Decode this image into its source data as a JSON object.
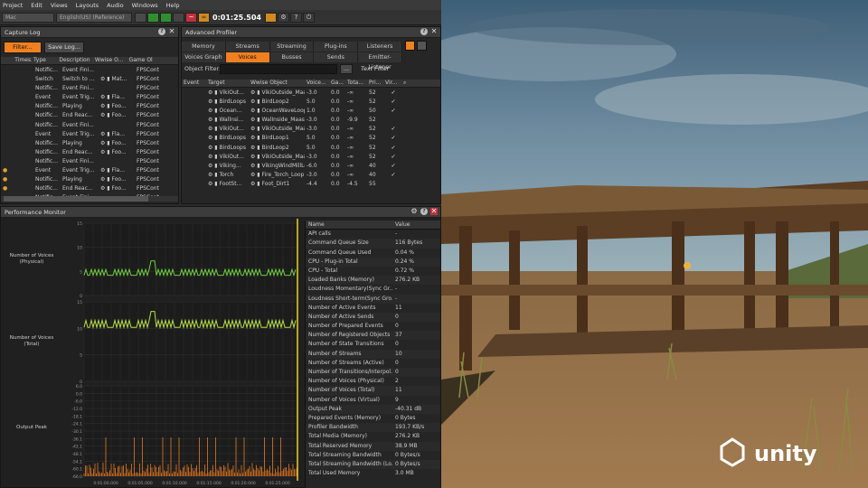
{
  "menu": [
    "Project",
    "Edit",
    "Views",
    "Layouts",
    "Audio",
    "Windows",
    "Help"
  ],
  "toolbar": {
    "platform": "Mac",
    "language": "English(US) (Reference)",
    "time": "0:01:25.504"
  },
  "capture_log": {
    "title": "Capture Log",
    "filter_label": "Filter...",
    "save_label": "Save Log...",
    "columns": [
      "Times...",
      "Type",
      "Description",
      "Wwise O...",
      "Game Ol"
    ],
    "rows": [
      {
        "dot": "",
        "type": "Notific...",
        "desc": "Event Fini...",
        "wo": "",
        "go": "FPSCont"
      },
      {
        "dot": "",
        "type": "Switch",
        "desc": "Switch to ...",
        "wo": "Mat...",
        "go": "FPSCont"
      },
      {
        "dot": "",
        "type": "Notific...",
        "desc": "Event Fini...",
        "wo": "",
        "go": "FPSCont"
      },
      {
        "dot": "",
        "type": "Event",
        "desc": "Event Trig...",
        "wo": "Fla...",
        "go": "FPSCont"
      },
      {
        "dot": "",
        "type": "Notific...",
        "desc": "Playing",
        "wo": "Foo...",
        "go": "FPSCont"
      },
      {
        "dot": "",
        "type": "Notific...",
        "desc": "End Reac...",
        "wo": "Foo...",
        "go": "FPSCont"
      },
      {
        "dot": "",
        "type": "Notific...",
        "desc": "Event Fini...",
        "wo": "",
        "go": "FPSCont"
      },
      {
        "dot": "",
        "type": "Event",
        "desc": "Event Trig...",
        "wo": "Fla...",
        "go": "FPSCont"
      },
      {
        "dot": "",
        "type": "Notific...",
        "desc": "Playing",
        "wo": "Foo...",
        "go": "FPSCont"
      },
      {
        "dot": "",
        "type": "Notific...",
        "desc": "End Reac...",
        "wo": "Foo...",
        "go": "FPSCont"
      },
      {
        "dot": "",
        "type": "Notific...",
        "desc": "Event Fini...",
        "wo": "",
        "go": "FPSCont"
      },
      {
        "dot": "#e0a030",
        "type": "Event",
        "desc": "Event Trig...",
        "wo": "Fla...",
        "go": "FPSCont"
      },
      {
        "dot": "#e0a030",
        "type": "Notific...",
        "desc": "Playing",
        "wo": "Foo...",
        "go": "FPSCont"
      },
      {
        "dot": "#e0a030",
        "type": "Notific...",
        "desc": "End Reac...",
        "wo": "Foo...",
        "go": "FPSCont"
      },
      {
        "dot": "",
        "type": "Notific...",
        "desc": "Event Fini...",
        "wo": "",
        "go": "FPSCont"
      }
    ]
  },
  "advanced_profiler": {
    "title": "Advanced Profiler",
    "tabs1": [
      "Memory",
      "Streams",
      "Streaming Devices",
      "Plug-ins",
      "Listeners"
    ],
    "tabs2": [
      "Voices Graph",
      "Voices",
      "Busses",
      "Sends",
      "Emitter-Listener"
    ],
    "active_tab": "Voices",
    "object_filter_label": "Object Filter:",
    "browse_label": "...",
    "text_filter": "Text Filter",
    "columns": [
      "Event",
      "Target",
      "Wwise Object",
      "Voice...",
      "Ga...",
      "Tota...",
      "Pri...",
      "Vir..."
    ],
    "rows": [
      {
        "target": "VikiOut...",
        "obj": "VikiOutside_Maas5...",
        "v": "-3.0",
        "g": "0.0",
        "t": "-∞",
        "p": "52",
        "vir": true,
        "c": "#3a9a3a"
      },
      {
        "target": "BirdLoops",
        "obj": "BirdLoop2",
        "v": "5.0",
        "g": "0.0",
        "t": "-∞",
        "p": "52",
        "vir": true,
        "c": "#3a9a3a"
      },
      {
        "target": "Ocean...",
        "obj": "OceanWaveLoop1",
        "v": "1.0",
        "g": "0.0",
        "t": "-∞",
        "p": "50",
        "vir": true,
        "c": "#3a9a3a"
      },
      {
        "target": "Wallnsi...",
        "obj": "WalInside_MaasSqu...",
        "v": "-3.0",
        "g": "0.0",
        "t": "-9.9",
        "p": "52",
        "vir": false,
        "c": "#3a9a3a"
      },
      {
        "target": "VikiOut...",
        "obj": "VikiOutside_Maas5...",
        "v": "-3.0",
        "g": "0.0",
        "t": "-∞",
        "p": "52",
        "vir": true,
        "c": "#3a9a3a"
      },
      {
        "target": "BirdLoops",
        "obj": "BirdLoop1",
        "v": "5.0",
        "g": "0.0",
        "t": "-∞",
        "p": "52",
        "vir": true,
        "c": "#3a9a3a"
      },
      {
        "target": "BirdLoops",
        "obj": "BirdLoop2",
        "v": "5.0",
        "g": "0.0",
        "t": "-∞",
        "p": "52",
        "vir": true,
        "c": "#3a9a3a"
      },
      {
        "target": "VikiOut...",
        "obj": "VikiOutside_Maas5...",
        "v": "-3.0",
        "g": "0.0",
        "t": "-∞",
        "p": "52",
        "vir": true,
        "c": "#3a9a3a"
      },
      {
        "target": "Viking...",
        "obj": "VikingWindMillLoop",
        "v": "-6.0",
        "g": "0.0",
        "t": "-∞",
        "p": "40",
        "vir": true,
        "c": "#3050c0"
      },
      {
        "target": "Torch",
        "obj": "Fire_Torch_Loop1",
        "v": "-3.0",
        "g": "0.0",
        "t": "-∞",
        "p": "40",
        "vir": true,
        "c": "#c03030"
      },
      {
        "target": "FootSt...",
        "obj": "Foot_Dirt1",
        "v": "-4.4",
        "g": "0.0",
        "t": "-4.5",
        "p": "55",
        "vir": false,
        "c": "#a09030"
      }
    ]
  },
  "performance_monitor": {
    "title": "Performance Monitor",
    "graphs": [
      {
        "label": "Number of Voices (Physical)",
        "ticks": [
          "15",
          "10",
          "5",
          "0"
        ]
      },
      {
        "label": "Number of Voices (Total)",
        "ticks": [
          "15",
          "10",
          "5",
          "0"
        ]
      },
      {
        "label": "Output Peak",
        "ticks": [
          "6.0",
          "0.0",
          "-6.0",
          "-12.0",
          "-18.1",
          "-24.1",
          "-30.1",
          "-36.1",
          "-42.1",
          "-48.1",
          "-54.1",
          "-60.1",
          "-66.0"
        ]
      }
    ],
    "time_ticks": [
      "0:01:00.000",
      "0:01:05.000",
      "0:01:10.000",
      "0:01:15.000",
      "0:01:20.000",
      "0:01:25.000"
    ],
    "stats_header": {
      "name": "Name",
      "value": "Value"
    },
    "stats": [
      {
        "k": "API calls",
        "v": "-"
      },
      {
        "k": "Command Queue Size",
        "v": "116 Bytes"
      },
      {
        "k": "Command Queue Used",
        "v": "0.04 %"
      },
      {
        "k": "CPU - Plug-in Total",
        "v": "0.24 %"
      },
      {
        "k": "CPU - Total",
        "v": "0.72 %"
      },
      {
        "k": "Loaded Banks (Memory)",
        "v": "276.2 KB"
      },
      {
        "k": "Loudness Momentary(Sync Gr...",
        "v": "-"
      },
      {
        "k": "Loudness Short-term(Sync Gro...",
        "v": "-"
      },
      {
        "k": "Number of Active Events",
        "v": "11"
      },
      {
        "k": "Number of Active Sends",
        "v": "0"
      },
      {
        "k": "Number of Prepared Events",
        "v": "0"
      },
      {
        "k": "Number of Registered Objects",
        "v": "37"
      },
      {
        "k": "Number of State Transitions",
        "v": "0"
      },
      {
        "k": "Number of Streams",
        "v": "10"
      },
      {
        "k": "Number of Streams (Active)",
        "v": "0"
      },
      {
        "k": "Number of Transitions/Interpol...",
        "v": "0"
      },
      {
        "k": "Number of Voices (Physical)",
        "v": "2"
      },
      {
        "k": "Number of Voices (Total)",
        "v": "11"
      },
      {
        "k": "Number of Voices (Virtual)",
        "v": "9"
      },
      {
        "k": "Output Peak",
        "v": "-40.31 dB"
      },
      {
        "k": "Prepared Events (Memory)",
        "v": "0 Bytes"
      },
      {
        "k": "Profiler Bandwidth",
        "v": "193.7 KB/s"
      },
      {
        "k": "Total Media (Memory)",
        "v": "276.2 KB"
      },
      {
        "k": "Total Reserved Memory",
        "v": "38.9 MB"
      },
      {
        "k": "Total Streaming Bandwidth",
        "v": "0 Bytes/s"
      },
      {
        "k": "Total Streaming Bandwidth (Lo...",
        "v": "0 Bytes/s"
      },
      {
        "k": "Total Used Memory",
        "v": "3.0 MB"
      }
    ]
  },
  "game_view": {
    "watermark": "unity"
  }
}
